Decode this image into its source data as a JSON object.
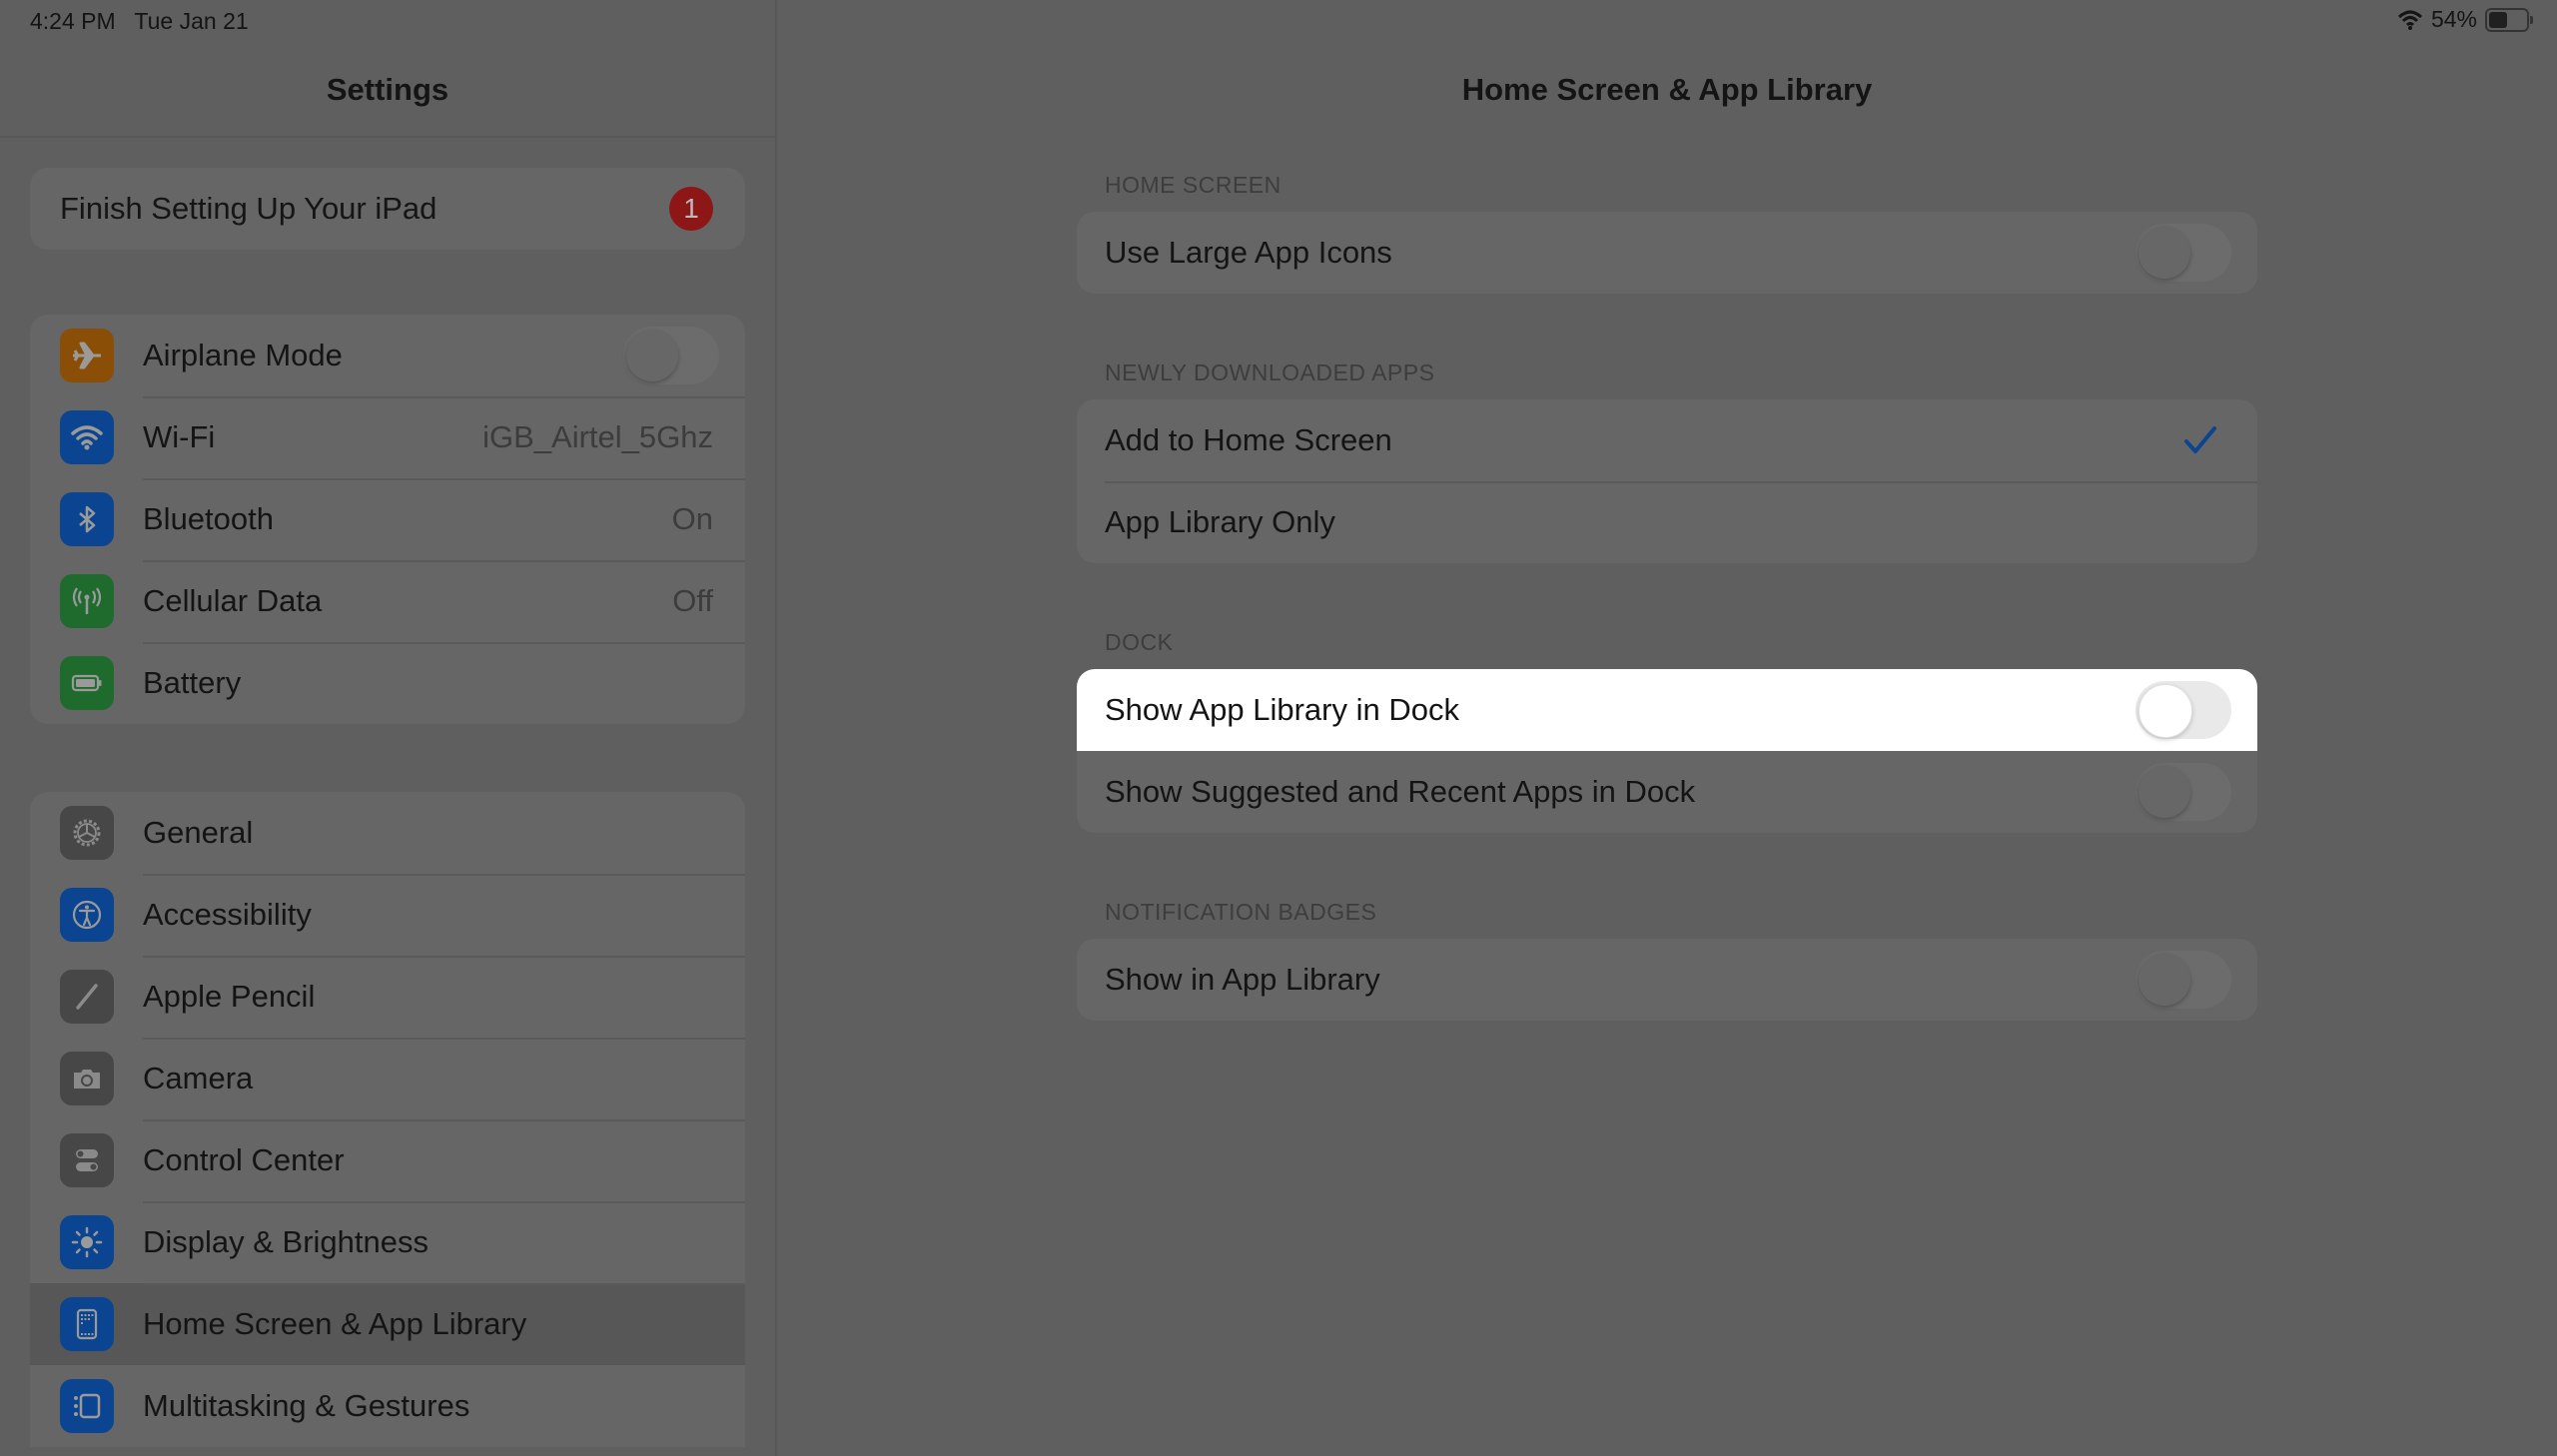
{
  "status_bar": {
    "time": "4:24 PM",
    "date": "Tue Jan 21",
    "battery_percent_label": "54%",
    "battery_level": 0.54
  },
  "sidebar": {
    "title": "Settings",
    "finish_setup": {
      "label": "Finish Setting Up Your iPad",
      "badge": "1"
    },
    "group1": [
      {
        "label": "Airplane Mode",
        "icon": "airplane-icon",
        "color": "#8a4e06",
        "toggle": false
      },
      {
        "label": "Wi-Fi",
        "icon": "wifi-icon",
        "color": "#0b4591",
        "value": "iGB_Airtel_5Ghz"
      },
      {
        "label": "Bluetooth",
        "icon": "bluetooth-icon",
        "color": "#0b4591",
        "value": "On"
      },
      {
        "label": "Cellular Data",
        "icon": "antenna-icon",
        "color": "#1f6b2e",
        "value": "Off"
      },
      {
        "label": "Battery",
        "icon": "battery-icon",
        "color": "#1f6b2e"
      }
    ],
    "group2": [
      {
        "label": "General",
        "icon": "gear-icon",
        "color": "#474747"
      },
      {
        "label": "Accessibility",
        "icon": "accessibility-icon",
        "color": "#0b4591"
      },
      {
        "label": "Apple Pencil",
        "icon": "pencil-icon",
        "color": "#474747"
      },
      {
        "label": "Camera",
        "icon": "camera-icon",
        "color": "#474747"
      },
      {
        "label": "Control Center",
        "icon": "switches-icon",
        "color": "#474747"
      },
      {
        "label": "Display & Brightness",
        "icon": "sun-icon",
        "color": "#0b4591"
      },
      {
        "label": "Home Screen & App Library",
        "icon": "home-screen-icon",
        "color": "#0b4591",
        "selected": true
      },
      {
        "label": "Multitasking & Gestures",
        "icon": "multitasking-icon",
        "color": "#0b4591"
      }
    ]
  },
  "main": {
    "title": "Home Screen & App Library",
    "sections": [
      {
        "header": "HOME SCREEN",
        "rows": [
          {
            "label": "Use Large App Icons",
            "toggle": false
          }
        ]
      },
      {
        "header": "NEWLY DOWNLOADED APPS",
        "rows": [
          {
            "label": "Add to Home Screen",
            "checked": true
          },
          {
            "label": "App Library Only",
            "checked": false
          }
        ]
      },
      {
        "header": "DOCK",
        "rows": [
          {
            "label": "Show App Library in Dock",
            "toggle": false,
            "highlighted": true
          },
          {
            "label": "Show Suggested and Recent Apps in Dock",
            "toggle": false
          }
        ]
      },
      {
        "header": "NOTIFICATION BADGES",
        "rows": [
          {
            "label": "Show in App Library",
            "toggle": false
          }
        ]
      }
    ],
    "accent_color": "#0b4591"
  }
}
